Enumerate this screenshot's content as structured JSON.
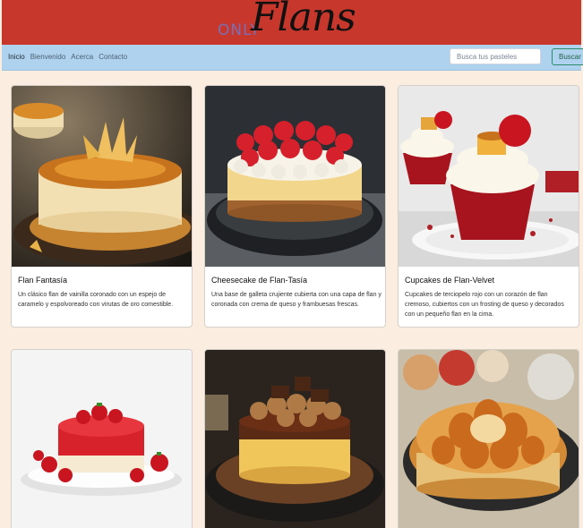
{
  "brand": {
    "only": "ONLY",
    "flans": "Flans",
    "colors": {
      "banner": "#c7372c",
      "navbar": "#afd3ee",
      "page": "#fbeee0"
    }
  },
  "nav": {
    "links": [
      "Inicio",
      "Bienvenido",
      "Acerca",
      "Contacto"
    ]
  },
  "search": {
    "placeholder": "Busca tus pasteles",
    "button": "Buscar"
  },
  "cards": [
    {
      "image": "flan-fantasia-photo",
      "title": "Flan Fantasía",
      "desc": "Un clásico flan de vainilla coronado con un espejo de caramelo y espolvoreado con virutas de oro comestible."
    },
    {
      "image": "cheesecake-flan-photo",
      "title": "Cheesecake de Flan-Tasía",
      "desc": "Una base de galleta crujiente cubierta con una capa de flan y coronada con crema de queso y frambuesas frescas."
    },
    {
      "image": "cupcakes-flan-velvet-photo",
      "title": "Cupcakes de Flan-Velvet",
      "desc": "Cupcakes de terciopelo rojo con un corazón de flan cremoso, cubiertos con un frosting de queso y decorados con un pequeño flan en la cima."
    },
    {
      "image": "strawberry-gelatin-flan-photo"
    },
    {
      "image": "chocolate-flan-cake-photo"
    },
    {
      "image": "apple-flan-tart-photo"
    }
  ]
}
